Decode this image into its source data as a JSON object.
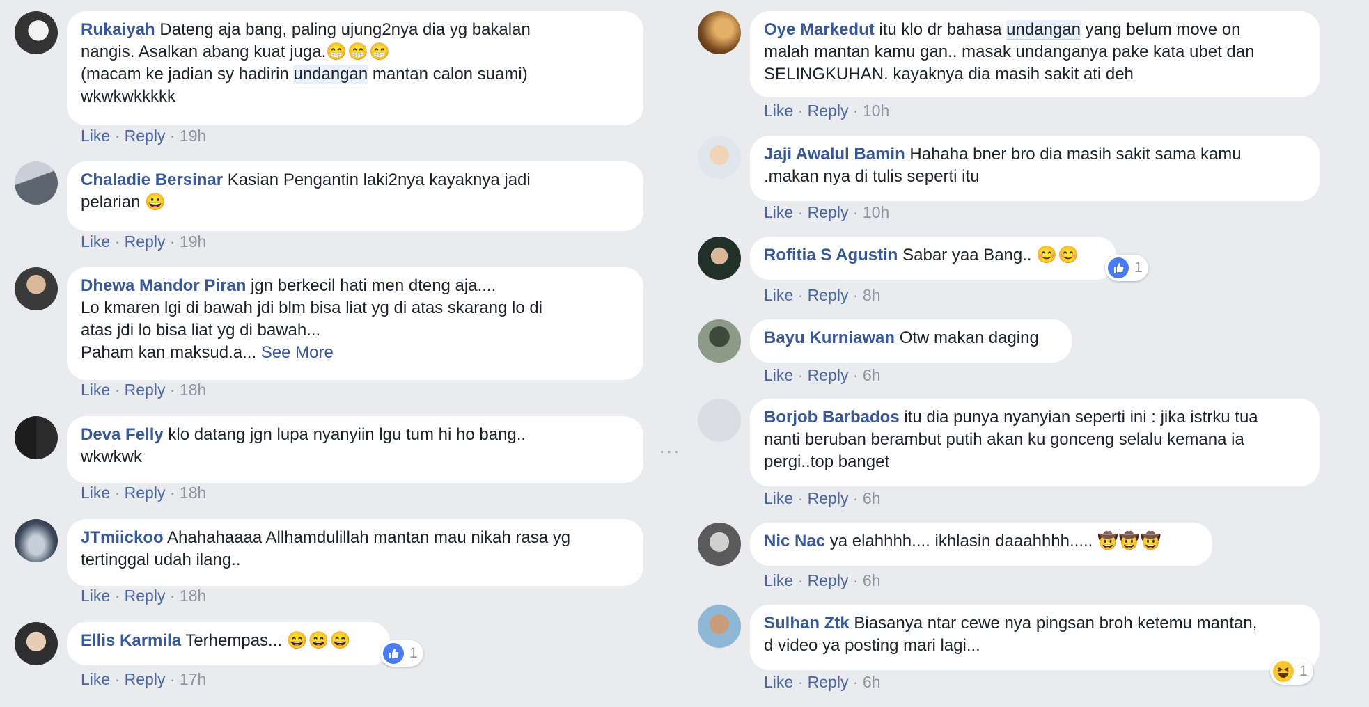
{
  "actions": {
    "like": "Like",
    "reply": "Reply",
    "sep": " · "
  },
  "more_dots": "···",
  "comments_left": [
    {
      "author": "Rukaiyah",
      "lines": [
        "Dateng aja bang, paling ujung2nya dia yg bakalan",
        "nangis. Asalkan abang kuat juga.",
        "(macam ke jadian sy hadirin ",
        "undangan",
        " mantan calon suami)",
        "wkwkwkkkkk"
      ],
      "emoji": "😁😁😁",
      "time": "19h"
    },
    {
      "author": "Chaladie Bersinar",
      "lines": [
        "Kasian Pengantin laki2nya kayaknya jadi",
        "pelarian"
      ],
      "emoji": "😀",
      "time": "19h"
    },
    {
      "author": "Dhewa Mandor Piran",
      "lines": [
        "jgn berkecil hati men dteng aja....",
        "Lo kmaren lgi di bawah jdi blm bisa liat yg di atas skarang lo di",
        "atas jdi lo bisa liat yg di bawah...",
        "Paham kan maksud.a..."
      ],
      "see_more": "See More",
      "time": "18h"
    },
    {
      "author": "Deva Felly",
      "lines": [
        "klo datang jgn lupa nyanyiin lgu tum hi ho bang..",
        "wkwkwk"
      ],
      "time": "18h"
    },
    {
      "author": "JTmiickoo",
      "lines": [
        "Ahahahaaaa Allhamdulillah mantan mau nikah rasa yg",
        "tertinggal udah ilang.."
      ],
      "time": "18h"
    },
    {
      "author": "Ellis Karmila",
      "lines": [
        "Terhempas..."
      ],
      "emoji": "😄😄😄",
      "reaction_count": "1",
      "time": "17h"
    }
  ],
  "comments_right": [
    {
      "author": "Oye Markedut",
      "lines": [
        "itu klo dr bahasa ",
        "undangan",
        " yang belum move on",
        "malah mantan kamu gan.. masak undanganya pake kata ubet dan",
        "SELINGKUHAN. kayaknya dia masih sakit ati deh"
      ],
      "time": "10h"
    },
    {
      "author": "Jaji Awalul Bamin",
      "lines": [
        "Hahaha bner bro dia masih sakit sama kamu",
        ".makan nya di tulis seperti itu"
      ],
      "time": "10h"
    },
    {
      "author": "Rofitia S Agustin",
      "lines": [
        "Sabar yaa Bang.."
      ],
      "emoji": "😊😊",
      "reaction_count": "1",
      "time": "8h"
    },
    {
      "author": "Bayu Kurniawan",
      "lines": [
        "Otw makan daging"
      ],
      "time": "6h"
    },
    {
      "author": "Borjob Barbados",
      "lines": [
        "itu dia punya nyanyian seperti ini : jika istrku tua",
        "nanti beruban berambut putih akan ku gonceng selalu kemana ia",
        "pergi..top banget"
      ],
      "time": "6h"
    },
    {
      "author": "Nic Nac",
      "lines": [
        "ya elahhhh.... ikhlasin daaahhhh....."
      ],
      "emoji": "🤠🤠🤠",
      "time": "6h"
    },
    {
      "author": "Sulhan Ztk",
      "lines": [
        "Biasanya ntar cewe nya pingsan broh ketemu mantan,",
        "d video ya posting mari lagi..."
      ],
      "reaction_count": "1",
      "time": "6h"
    }
  ],
  "colors": {
    "background": "#e9ebee",
    "author": "#385898",
    "action": "#4b67a1",
    "meta": "#90949c",
    "like_blue": "#4a7bf0",
    "highlight": "#e7f0fb"
  },
  "icons": [
    "like-reaction-icon",
    "haha-reaction-icon",
    "more-options-icon"
  ]
}
